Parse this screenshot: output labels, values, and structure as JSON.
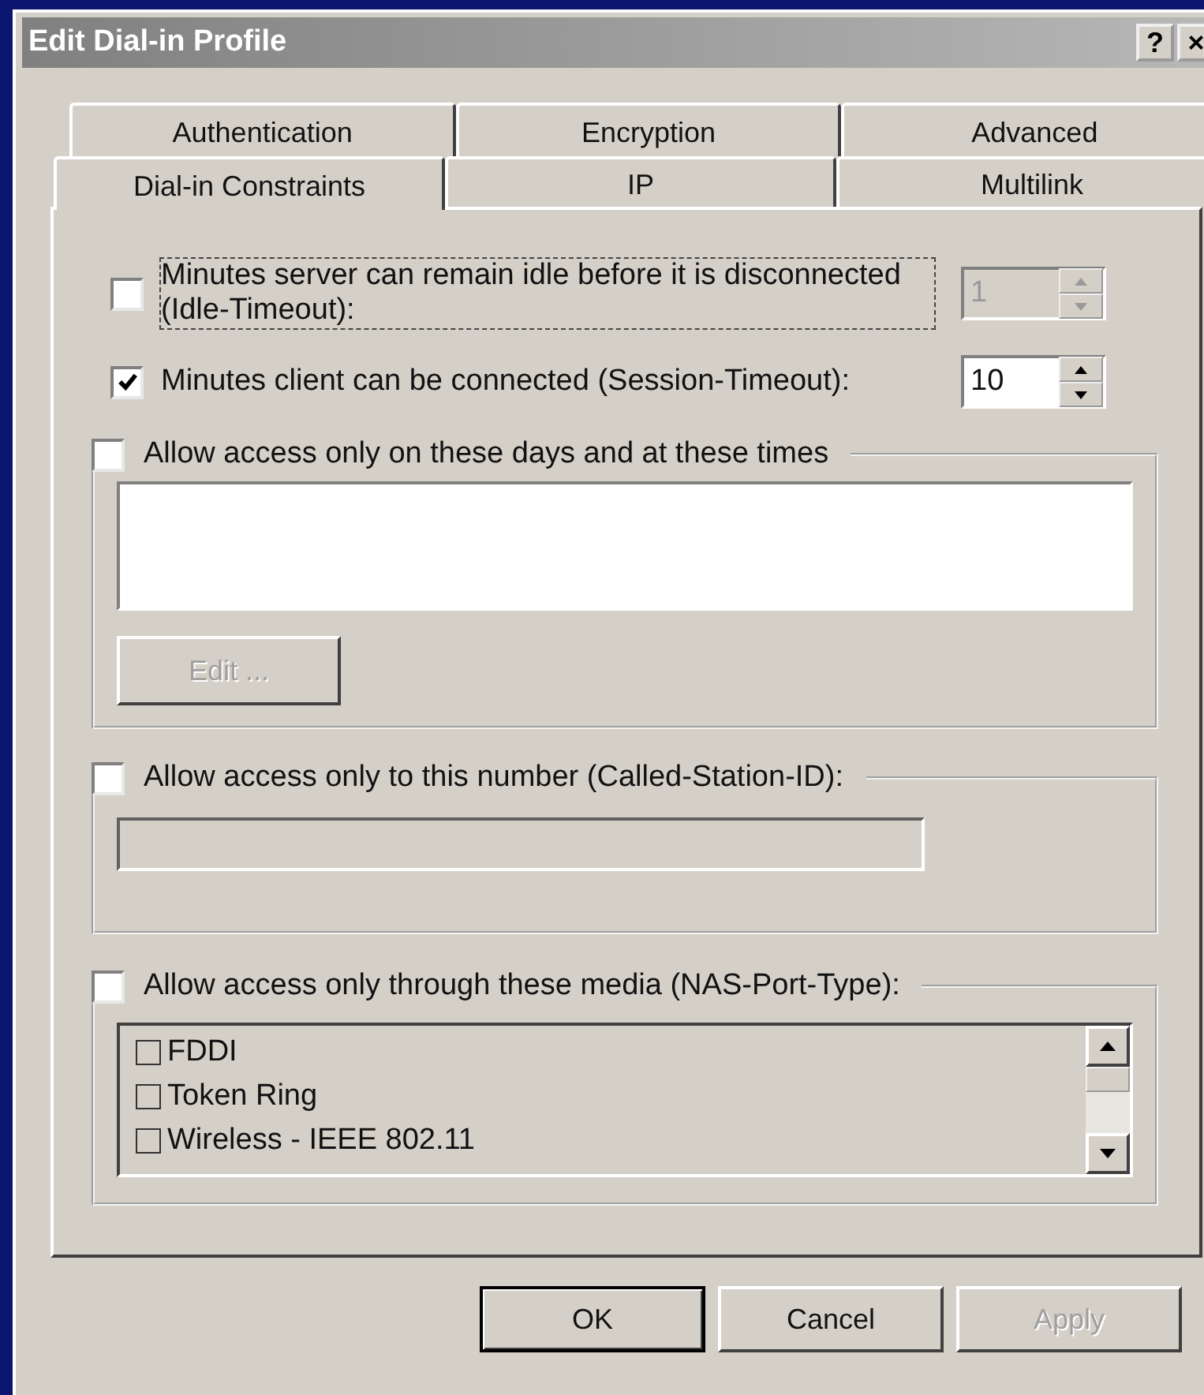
{
  "window": {
    "title": "Edit Dial-in Profile",
    "buttons": [
      "?",
      "×"
    ]
  },
  "tab_rows": [
    [
      {
        "label": "Authentication",
        "selected": false
      },
      {
        "label": "Encryption",
        "selected": false
      },
      {
        "label": "Advanced",
        "selected": false
      }
    ],
    [
      {
        "label": "Dial-in Constraints",
        "selected": true
      },
      {
        "label": "IP",
        "selected": false
      },
      {
        "label": "Multilink",
        "selected": false
      }
    ]
  ],
  "timeouts": [
    {
      "label": "Minutes server can remain idle before it is disconnected (Idle-Timeout):",
      "checked": false,
      "focused": true,
      "value": "1",
      "disabled": true
    },
    {
      "label": "Minutes client can be connected (Session-Timeout):",
      "checked": true,
      "focused": false,
      "value": "10",
      "disabled": false
    }
  ],
  "days_group": {
    "label": "Allow access only on these days and at these times",
    "checked": false,
    "edit_button": {
      "label": "Edit ...",
      "disabled": true
    }
  },
  "number_group": {
    "label": "Allow access only to this number (Called-Station-ID):",
    "checked": false,
    "field_disabled": true
  },
  "media_group": {
    "label": "Allow access only through these media (NAS-Port-Type):",
    "checked": false,
    "items": [
      {
        "label": "FDDI",
        "checked": false
      },
      {
        "label": "Token Ring",
        "checked": false
      },
      {
        "label": "Wireless - IEEE 802.11",
        "checked": false
      }
    ]
  },
  "buttons": [
    {
      "label": "OK",
      "disabled": false,
      "default": true
    },
    {
      "label": "Cancel",
      "disabled": false,
      "default": false
    },
    {
      "label": "Apply",
      "disabled": true,
      "default": false
    }
  ]
}
